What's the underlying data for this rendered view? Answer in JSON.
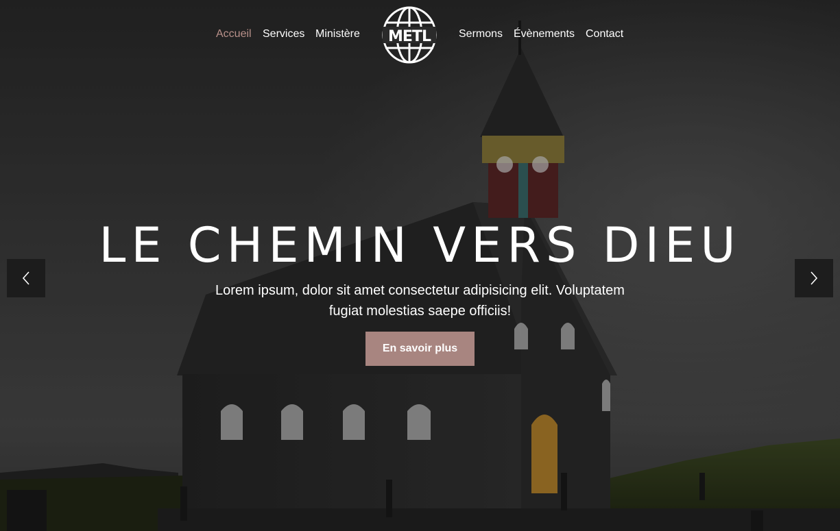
{
  "nav": {
    "left": [
      "Accueil",
      "Services",
      "Ministère"
    ],
    "right": [
      "Sermons",
      "Évènements",
      "Contact"
    ],
    "active": "Accueil"
  },
  "logo": {
    "text": "METL"
  },
  "hero": {
    "title": "LE CHEMIN VERS DIEU",
    "subtitle_line1": "Lorem ipsum, dolor sit amet consectetur adipisicing elit. Voluptatem",
    "subtitle_line2": "fugiat molestias saepe officiis!",
    "cta": "En savoir plus"
  },
  "icons": {
    "prev": "chevron-left-icon",
    "next": "chevron-right-icon",
    "logo": "globe-logo-icon"
  },
  "colors": {
    "accent": "#a88580",
    "active_link": "#b9918a",
    "overlay": "#1e1e1e"
  }
}
